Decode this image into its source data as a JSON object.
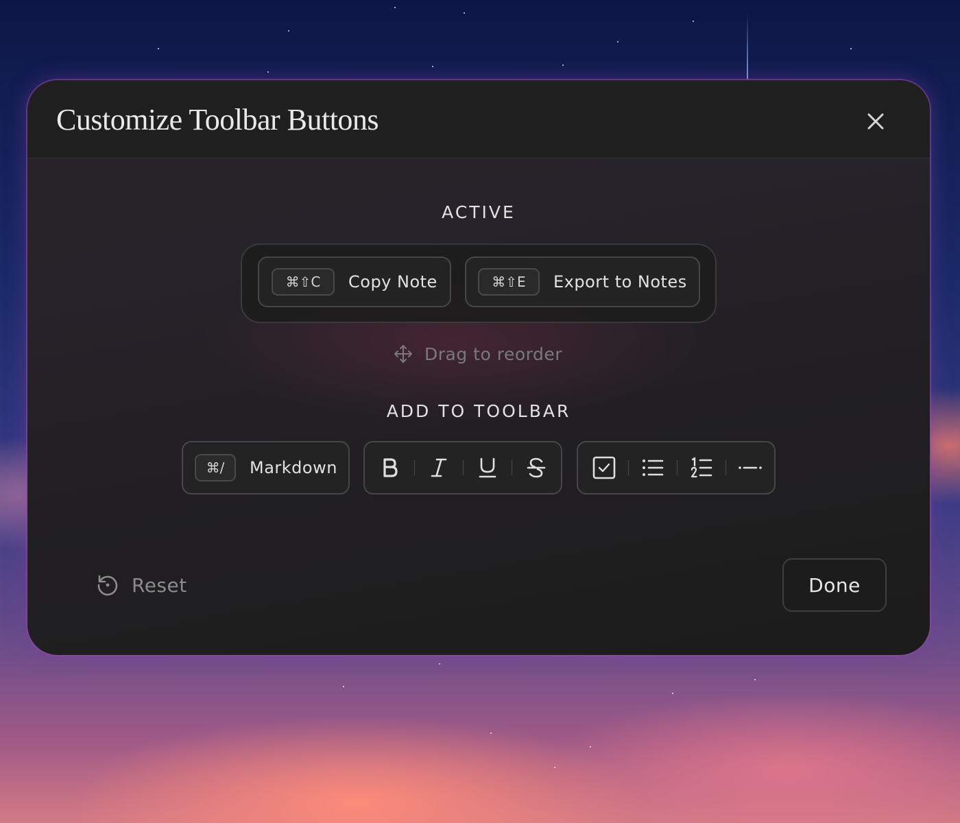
{
  "dialog": {
    "title": "Customize Toolbar Buttons",
    "close_icon": "close-icon"
  },
  "active": {
    "heading": "ACTIVE",
    "items": [
      {
        "shortcut": "⌘⇧C",
        "label": "Copy Note"
      },
      {
        "shortcut": "⌘⇧E",
        "label": "Export to Notes"
      }
    ],
    "hint": "Drag to reorder",
    "hint_icon": "move-icon"
  },
  "add": {
    "heading": "ADD TO TOOLBAR",
    "markdown": {
      "shortcut": "⌘/",
      "label": "Markdown"
    },
    "formatting_icons": [
      "bold-icon",
      "italic-icon",
      "underline-icon",
      "strikethrough-icon"
    ],
    "list_icons": [
      "checkbox-icon",
      "bullet-list-icon",
      "numbered-list-icon",
      "divider-icon"
    ]
  },
  "footer": {
    "reset_label": "Reset",
    "reset_icon": "reset-icon",
    "done_label": "Done"
  }
}
